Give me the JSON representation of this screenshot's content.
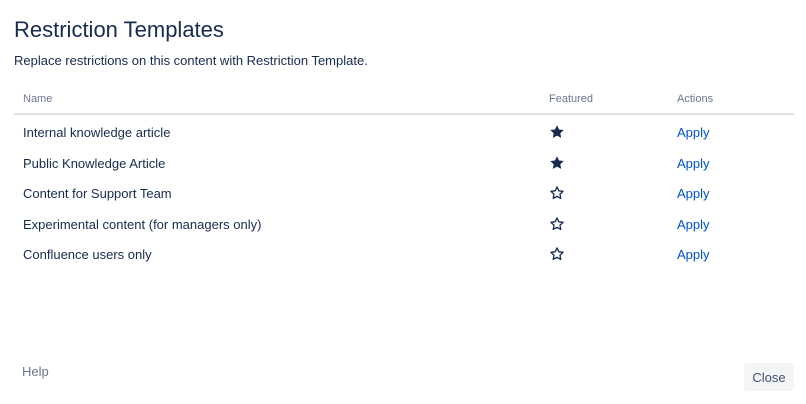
{
  "dialog": {
    "title": "Restriction Templates",
    "subtitle": "Replace restrictions on this content with Restriction Template."
  },
  "table": {
    "columns": {
      "name": "Name",
      "featured": "Featured",
      "actions": "Actions"
    },
    "rows": [
      {
        "name": "Internal knowledge article",
        "featured": true,
        "action": "Apply"
      },
      {
        "name": "Public Knowledge Article",
        "featured": true,
        "action": "Apply"
      },
      {
        "name": "Content for Support Team",
        "featured": false,
        "action": "Apply"
      },
      {
        "name": "Experimental content (for managers only)",
        "featured": false,
        "action": "Apply"
      },
      {
        "name": "Confluence users only",
        "featured": false,
        "action": "Apply"
      }
    ]
  },
  "footer": {
    "help_label": "Help",
    "close_label": "Close"
  },
  "colors": {
    "link": "#0052cc",
    "text": "#172b4d",
    "muted": "#6b778c"
  },
  "icons": {
    "featured_on": "star-filled-icon",
    "featured_off": "star-outline-icon"
  }
}
